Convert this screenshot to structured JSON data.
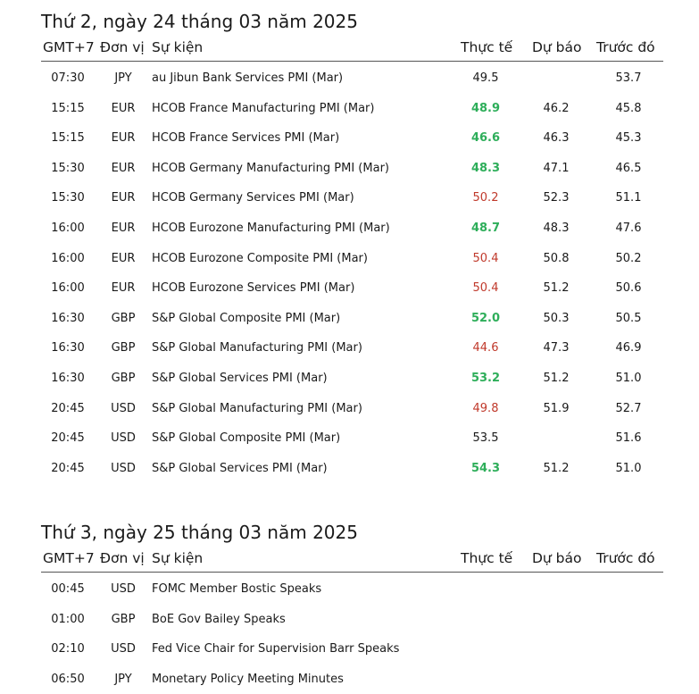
{
  "columns": {
    "time": "GMT+7",
    "currency": "Đơn vị",
    "event": "Sự kiện",
    "actual": "Thực tế",
    "forecast": "Dự báo",
    "previous": "Trước đó"
  },
  "colors": {
    "better": "#2eae5a",
    "worse": "#c0392b",
    "neutral": "#1a1a1a"
  },
  "days": [
    {
      "title": "Thứ 2, ngày 24 tháng 03 năm 2025",
      "rows": [
        {
          "time": "07:30",
          "currency": "JPY",
          "event": "au Jibun Bank Services PMI (Mar)",
          "actual": "49.5",
          "status": "neutral",
          "forecast": "",
          "previous": "53.7"
        },
        {
          "time": "15:15",
          "currency": "EUR",
          "event": "HCOB France Manufacturing PMI (Mar)",
          "actual": "48.9",
          "status": "better",
          "forecast": "46.2",
          "previous": "45.8"
        },
        {
          "time": "15:15",
          "currency": "EUR",
          "event": "HCOB France Services PMI (Mar)",
          "actual": "46.6",
          "status": "better",
          "forecast": "46.3",
          "previous": "45.3"
        },
        {
          "time": "15:30",
          "currency": "EUR",
          "event": "HCOB Germany Manufacturing PMI (Mar)",
          "actual": "48.3",
          "status": "better",
          "forecast": "47.1",
          "previous": "46.5"
        },
        {
          "time": "15:30",
          "currency": "EUR",
          "event": "HCOB Germany Services PMI (Mar)",
          "actual": "50.2",
          "status": "worse",
          "forecast": "52.3",
          "previous": "51.1"
        },
        {
          "time": "16:00",
          "currency": "EUR",
          "event": "HCOB Eurozone Manufacturing PMI (Mar)",
          "actual": "48.7",
          "status": "better",
          "forecast": "48.3",
          "previous": "47.6"
        },
        {
          "time": "16:00",
          "currency": "EUR",
          "event": "HCOB Eurozone Composite PMI (Mar)",
          "actual": "50.4",
          "status": "worse",
          "forecast": "50.8",
          "previous": "50.2"
        },
        {
          "time": "16:00",
          "currency": "EUR",
          "event": "HCOB Eurozone Services PMI (Mar)",
          "actual": "50.4",
          "status": "worse",
          "forecast": "51.2",
          "previous": "50.6"
        },
        {
          "time": "16:30",
          "currency": "GBP",
          "event": "S&P Global Composite PMI (Mar)",
          "actual": "52.0",
          "status": "better",
          "forecast": "50.3",
          "previous": "50.5"
        },
        {
          "time": "16:30",
          "currency": "GBP",
          "event": "S&P Global Manufacturing PMI (Mar)",
          "actual": "44.6",
          "status": "worse",
          "forecast": "47.3",
          "previous": "46.9"
        },
        {
          "time": "16:30",
          "currency": "GBP",
          "event": "S&P Global Services PMI (Mar)",
          "actual": "53.2",
          "status": "better",
          "forecast": "51.2",
          "previous": "51.0"
        },
        {
          "time": "20:45",
          "currency": "USD",
          "event": "S&P Global Manufacturing PMI (Mar)",
          "actual": "49.8",
          "status": "worse",
          "forecast": "51.9",
          "previous": "52.7"
        },
        {
          "time": "20:45",
          "currency": "USD",
          "event": "S&P Global Composite PMI (Mar)",
          "actual": "53.5",
          "status": "neutral",
          "forecast": "",
          "previous": "51.6"
        },
        {
          "time": "20:45",
          "currency": "USD",
          "event": "S&P Global Services PMI (Mar)",
          "actual": "54.3",
          "status": "better",
          "forecast": "51.2",
          "previous": "51.0"
        }
      ]
    },
    {
      "title": "Thứ 3, ngày 25 tháng 03 năm 2025",
      "rows": [
        {
          "time": "00:45",
          "currency": "USD",
          "event": "FOMC Member Bostic Speaks",
          "actual": "",
          "status": "neutral",
          "forecast": "",
          "previous": ""
        },
        {
          "time": "01:00",
          "currency": "GBP",
          "event": "BoE Gov Bailey Speaks",
          "actual": "",
          "status": "neutral",
          "forecast": "",
          "previous": ""
        },
        {
          "time": "02:10",
          "currency": "USD",
          "event": "Fed Vice Chair for Supervision Barr Speaks",
          "actual": "",
          "status": "neutral",
          "forecast": "",
          "previous": ""
        },
        {
          "time": "06:50",
          "currency": "JPY",
          "event": "Monetary Policy Meeting Minutes",
          "actual": "",
          "status": "neutral",
          "forecast": "",
          "previous": ""
        }
      ]
    }
  ]
}
